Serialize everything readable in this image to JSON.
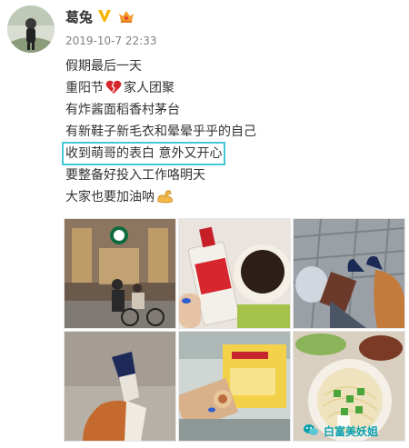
{
  "post": {
    "username": "葛兔",
    "timestamp": "2019-10-7 22:33",
    "lines": [
      "假期最后一天",
      "重阳节",
      "家人团聚",
      "有炸酱面稻香村茅台",
      "有新鞋子新毛衣和晕晕乎乎的自己",
      "收到萌哥的表白 意外又开心",
      "要整备好投入工作咯明天",
      "大家也要加油呐"
    ]
  },
  "photos": [
    {
      "name": "starbucks-street-photo"
    },
    {
      "name": "moutai-and-dessert-photo"
    },
    {
      "name": "new-shoes-photo"
    },
    {
      "name": "shoe-on-floor-photo"
    },
    {
      "name": "daoxiangcun-box-photo"
    },
    {
      "name": "zhajiang-noodles-photo"
    }
  ],
  "watermark": {
    "text": "白富美妖姐"
  },
  "colors": {
    "highlight": "#45c8d6",
    "verified": "#f7b500",
    "watermark": "#0aa0b0"
  }
}
